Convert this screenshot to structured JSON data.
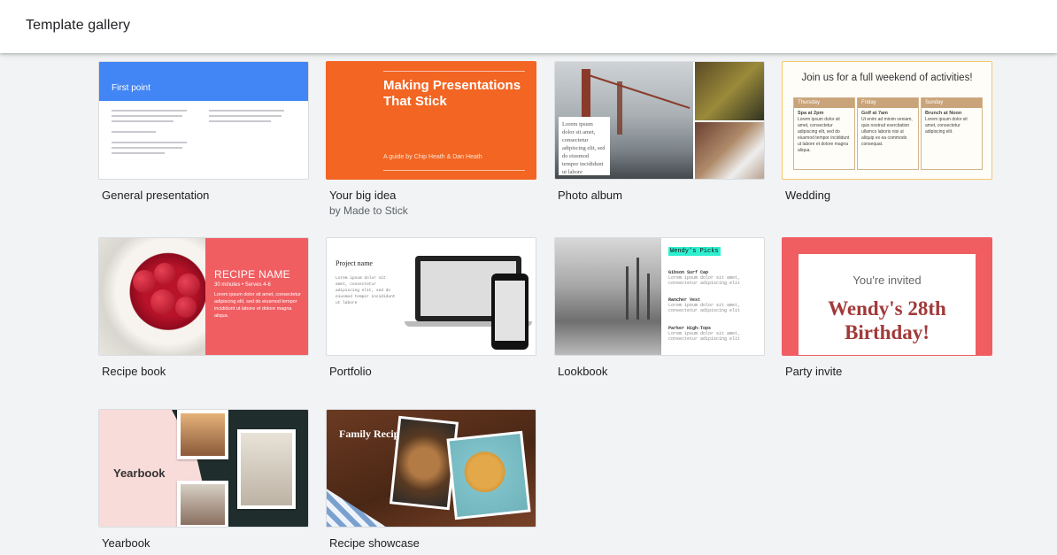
{
  "header": {
    "title": "Template gallery"
  },
  "templates": [
    {
      "name": "General presentation",
      "thumb": {
        "heading": "First point"
      }
    },
    {
      "name": "Your big idea",
      "byline": "by Made to Stick",
      "thumb": {
        "heading": "Making Presentations That Stick",
        "sub": "A guide by Chip Heath & Dan Heath"
      }
    },
    {
      "name": "Photo album",
      "thumb": {
        "caption": "Lorem ipsum dolor sit amet, consectetur adipiscing elit, sed do eiusmod tempor incididunt ut labore"
      }
    },
    {
      "name": "Wedding",
      "thumb": {
        "heading": "Join us for a full weekend of activities!",
        "days": [
          {
            "day": "Thursday",
            "event": "Spa at 2pm",
            "text": "Lorem ipsum dolor sit amet, consectetur adipiscing elit, sed do eiusmod tempor incididunt ut labore et dolore magna aliqua."
          },
          {
            "day": "Friday",
            "event": "Golf at 7am",
            "text": "Ut enim ad minim veniam, quis nostrud exercitation ullamco laboris nisi ut aliquip ex ea commodo consequat."
          },
          {
            "day": "Sunday",
            "event": "Brunch at Noon",
            "text": "Lorem ipsum dolor sit amet, consectetur adipiscing elit."
          }
        ]
      }
    },
    {
      "name": "Recipe book",
      "thumb": {
        "heading": "RECIPE NAME",
        "sub": "30 minutes • Serves 4-6",
        "body": "Lorem ipsum dolor sit amet, consectetur adipiscing elit, sed do eiusmod tempor incididunt ut labore et dolore magna aliqua."
      }
    },
    {
      "name": "Portfolio",
      "thumb": {
        "heading": "Project name",
        "body": "Lorem ipsum dolor sit amet, consectetur adipiscing elit, sed do eiusmod tempor incididunt ut labore"
      }
    },
    {
      "name": "Lookbook",
      "thumb": {
        "heading": "Wendy's Picks",
        "items": [
          {
            "title": "Gibson Surf Cap",
            "text": "Lorem ipsum dolor sit amet, consectetur adipiscing elit"
          },
          {
            "title": "Rancher Vest",
            "text": "Lorem ipsum dolor sit amet, consectetur adipiscing elit"
          },
          {
            "title": "Parker High-Tops",
            "text": "Lorem ipsum dolor sit amet, consectetur adipiscing elit"
          }
        ]
      }
    },
    {
      "name": "Party invite",
      "thumb": {
        "sub": "You're invited",
        "heading": "Wendy's 28th Birthday!"
      }
    },
    {
      "name": "Yearbook",
      "thumb": {
        "heading": "Yearbook"
      }
    },
    {
      "name": "Recipe showcase",
      "thumb": {
        "heading": "Family Recipes"
      }
    }
  ]
}
